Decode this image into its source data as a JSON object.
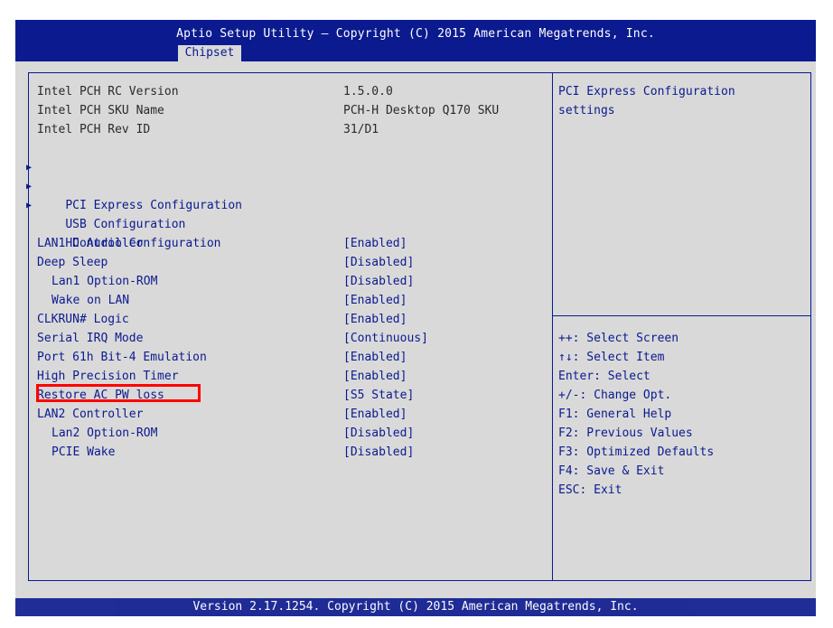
{
  "header": {
    "title": "Aptio Setup Utility – Copyright (C) 2015 American Megatrends, Inc.",
    "active_tab": "Chipset"
  },
  "info_rows": [
    {
      "label": "Intel PCH RC Version",
      "value": "1.5.0.0"
    },
    {
      "label": "Intel PCH SKU Name",
      "value": "PCH-H Desktop Q170 SKU"
    },
    {
      "label": "Intel PCH Rev ID",
      "value": "31/D1"
    }
  ],
  "submenus": [
    "PCI Express Configuration",
    "USB Configuration",
    "HD Audio Configuration"
  ],
  "settings": [
    {
      "label": "LAN1 Controller",
      "value": "[Enabled]"
    },
    {
      "label": "Deep Sleep",
      "value": "[Disabled]"
    },
    {
      "label": "Lan1 Option-ROM",
      "value": "[Disabled]"
    },
    {
      "label": "Wake on LAN",
      "value": "[Enabled]"
    },
    {
      "label": "CLKRUN# Logic",
      "value": "[Enabled]"
    },
    {
      "label": "Serial IRQ Mode",
      "value": "[Continuous]"
    },
    {
      "label": "Port 61h Bit-4 Emulation",
      "value": "[Enabled]"
    },
    {
      "label": "High Precision Timer",
      "value": "[Enabled]"
    },
    {
      "label": "Restore AC PW loss",
      "value": "[S5 State]"
    },
    {
      "label": "LAN2 Controller",
      "value": "[Enabled]"
    },
    {
      "label": "Lan2 Option-ROM",
      "value": "[Disabled]"
    },
    {
      "label": "PCIE Wake",
      "value": "[Disabled]"
    }
  ],
  "help_panel": {
    "line1": "PCI Express Configuration",
    "line2": "settings"
  },
  "key_help": [
    "++: Select Screen",
    "↑↓: Select Item",
    "Enter: Select",
    "+/-: Change Opt.",
    "F1: General Help",
    "F2: Previous Values",
    "F3: Optimized Defaults",
    "F4: Save & Exit",
    "ESC: Exit"
  ],
  "footer": {
    "text": "Version 2.17.1254. Copyright (C) 2015 American Megatrends, Inc."
  },
  "colors": {
    "bios_blue": "#0b1a8f",
    "background_gray": "#d9d9d9",
    "highlight_red": "#ff0000"
  },
  "icons": {
    "submenu_marker": "triangle-right-icon"
  }
}
